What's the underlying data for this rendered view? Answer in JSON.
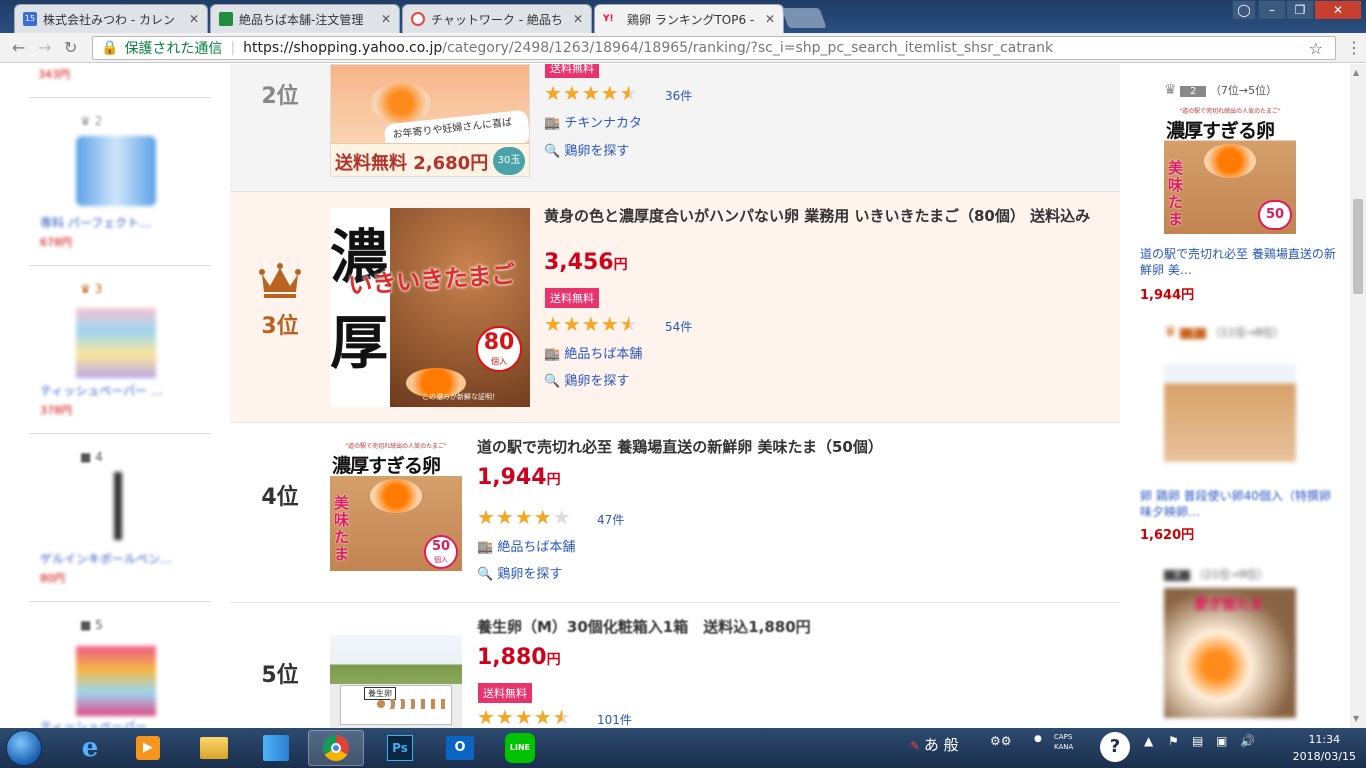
{
  "tabs": [
    {
      "title": "株式会社みつわ - カレン",
      "favicon_color": "#3a6fd1",
      "favicon_text": "15"
    },
    {
      "title": "絶品ちば本舗-注文管理",
      "favicon_color": "#1e8e3e",
      "favicon_text": ""
    },
    {
      "title": "チャットワーク - 絶品ち",
      "favicon_color": "#e8453c",
      "favicon_text": ""
    },
    {
      "title": "鶏卵 ランキングTOP6 -",
      "favicon_color": "#ff0033",
      "favicon_text": "Y!"
    }
  ],
  "address_bar": {
    "secure_label": "保護された通信",
    "host": "https://shopping.yahoo.co.jp",
    "path": "/category/2498/1263/18964/18965/ranking/?sc_i=shp_pc_search_itemlist_shsr_catrank"
  },
  "left_column": {
    "top_price": "343円",
    "items": [
      {
        "name": "専科 パーフェクト…",
        "price": "678円",
        "crown": "2"
      },
      {
        "name": "ティッシュペーパー …",
        "price": "378円",
        "crown": "3"
      },
      {
        "name": "ゲルインキボールペン…",
        "price": "80円",
        "crown": "4"
      },
      {
        "name": "ティッシュペーパー",
        "price": "",
        "crown": "5"
      }
    ]
  },
  "rankings": [
    {
      "rank": "2位",
      "title": "",
      "badge": "送料無料",
      "stars": 4.5,
      "review_count": "36件",
      "shop": "チキンナカタ",
      "find_label": "鶏卵を探す",
      "thumb_caption": "お年寄りや妊婦さんに喜ばれる!",
      "thumb_price_text": "送料無料 2,680円",
      "thumb_count": "30玉"
    },
    {
      "rank": "3位",
      "title": "黄身の色と濃厚度合いがハンパない卵 業務用 いきいきたまご（80個） 送料込み",
      "price": "3,456",
      "yen": "円",
      "badge": "送料無料",
      "stars": 4.5,
      "review_count": "54件",
      "shop": "絶品ちば本舗",
      "find_label": "鶏卵を探す",
      "thumb_big1": "濃",
      "thumb_big2": "厚",
      "thumb_title": "いきいきたまご",
      "thumb_count": "80",
      "thumb_count_unit": "個入",
      "thumb_caption": "この濃みが新鮮な証明！"
    },
    {
      "rank": "4位",
      "title": "道の駅で売切れ必至 養鶏場直送の新鮮卵 美味たま（50個）",
      "price": "1,944",
      "yen": "円",
      "stars": 4.0,
      "review_count": "47件",
      "shop": "絶品ちば本舗",
      "find_label": "鶏卵を探す",
      "thumb_top": "\"道の駅で売切れ続出の人気のたまご\"",
      "thumb_title": "濃厚すぎる卵",
      "thumb_sub": "美味たま",
      "thumb_count": "50",
      "thumb_count_unit": "個入"
    },
    {
      "rank": "5位",
      "title": "養生卵（M）30個化粧箱入1箱　送料込1,880円",
      "price": "1,880",
      "yen": "円",
      "badge": "送料無料",
      "stars": 4.5,
      "review_count": "101件",
      "thumb_label": "養生卵"
    }
  ],
  "right_column": {
    "items": [
      {
        "crown": "2",
        "move": "（7位→5位）",
        "name": "道の駅で売切れ必至 養鶏場直送の新鮮卵 美…",
        "price": "1,944円",
        "thumb_title": "濃厚すぎる卵",
        "thumb_sub": "美味たま",
        "thumb_count": "50",
        "thumb_top": "\"道の駅で売切れ続出の人気のたまご\""
      },
      {
        "crown": "3",
        "move": "（11位→8位）",
        "name": "卵 鶏卵 普段使い卵40個入（特撰卵味夕映卵…",
        "price": "1,620円"
      },
      {
        "crown": "4",
        "move": "（21位→9位）",
        "name": "",
        "price": "",
        "thumb_title": "愛ぎ惚たま"
      }
    ]
  },
  "taskbar": {
    "ime_text": "あ 般",
    "caps": "CAPS",
    "kana": "KANA",
    "time": "11:34",
    "date": "2018/03/15"
  }
}
